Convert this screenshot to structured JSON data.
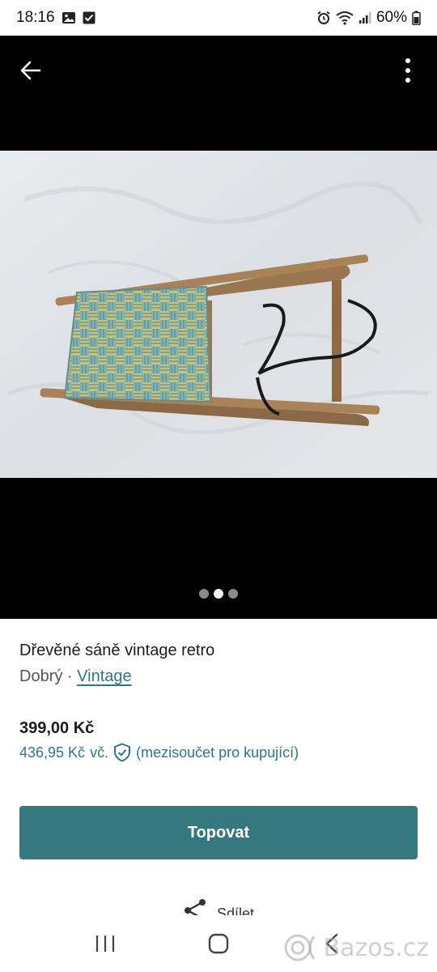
{
  "status_bar": {
    "time": "18:16",
    "battery": "60%"
  },
  "media": {
    "image_alt": "Dřevěné sáně na sněhu",
    "slide_count": 3,
    "active_slide": 2
  },
  "listing": {
    "title": "Dřevěné sáně vintage retro",
    "condition": "Dobrý",
    "separator": "·",
    "brand": "Vintage",
    "price": "399,00 Kč",
    "buyer_price": "436,95 Kč",
    "buyer_price_suffix": "vč.",
    "buyer_price_note": "(mezisoučet pro kupující)"
  },
  "actions": {
    "promote_label": "Topovat",
    "share_label": "Sdílet"
  },
  "watermark": {
    "text": "Bazos.cz"
  },
  "colors": {
    "accent": "#357880",
    "link": "#2e7780"
  }
}
